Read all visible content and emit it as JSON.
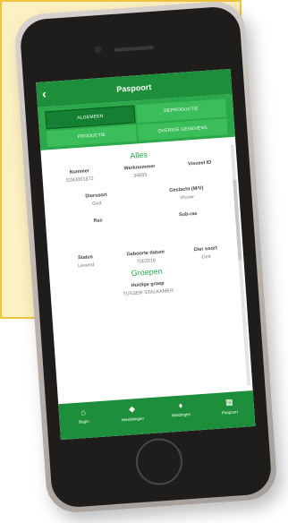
{
  "colors": {
    "accent": "#2aa84a",
    "header": "#1d8f3a",
    "tab_active": "#138032"
  },
  "header": {
    "back_icon": "chevron-left-icon",
    "title": "Paspoort"
  },
  "tabs": [
    {
      "label": "ALGEMEEN",
      "active": true
    },
    {
      "label": "REPRODUCTIE",
      "active": false
    },
    {
      "label": "PRODUCTIE",
      "active": false
    },
    {
      "label": "OVERIGE GEGEVENS",
      "active": false
    }
  ],
  "section_alles": {
    "title": "Alles",
    "nummer_label": "Nummer",
    "nummer_value": "5283001872",
    "werknummer_label": "Werknummer",
    "werknummer_value": "34693",
    "visueel_label": "Visueel ID",
    "visueel_value": ""
  },
  "diersoort": {
    "label": "Diersoort",
    "value": "Geit"
  },
  "geslacht": {
    "label": "Geslacht (M/V)",
    "value": "Vrouw"
  },
  "ras": {
    "label": "Ras",
    "value": ""
  },
  "subras": {
    "label": "Sub-ras",
    "value": ""
  },
  "status": {
    "label": "Status",
    "value": "Levend"
  },
  "geboortedatum": {
    "label": "Geboorte datum",
    "value": "7/3/2018"
  },
  "diersoort2": {
    "label": "Dier soort",
    "value": "Geit"
  },
  "groepen": {
    "title": "Groepen",
    "huidige_label": "Huidige groep",
    "huidige_value": "TUSSER STALKAMER"
  },
  "bottom_nav": [
    {
      "label": "Begin",
      "icon": "home-icon"
    },
    {
      "label": "Handelingen",
      "icon": "tag-icon"
    },
    {
      "label": "Meldingen",
      "icon": "bell-icon"
    },
    {
      "label": "Paspoort",
      "icon": "passport-icon"
    }
  ]
}
